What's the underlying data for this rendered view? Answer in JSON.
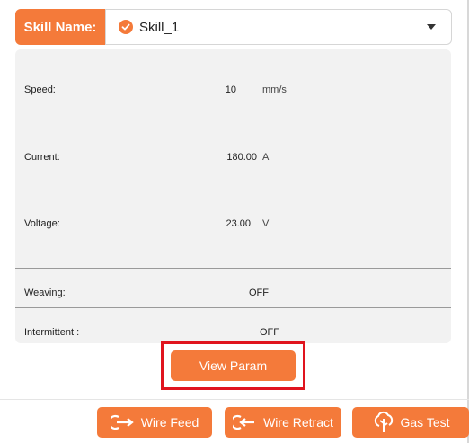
{
  "skill": {
    "label": "Skill Name:",
    "selected": "Skill_1"
  },
  "params": {
    "speed": {
      "label": "Speed:",
      "value": "10",
      "unit": "mm/s"
    },
    "current": {
      "label": "Current:",
      "value": "180.00",
      "unit": "A"
    },
    "voltage": {
      "label": "Voltage:",
      "value": "23.00",
      "unit": "V"
    },
    "weaving": {
      "label": "Weaving:",
      "value": "OFF"
    },
    "intermittent": {
      "label": "Intermittent :",
      "value": "OFF"
    }
  },
  "view_param": {
    "label": "View Param"
  },
  "actions": {
    "wire_feed": {
      "label": "Wire Feed",
      "icon": "wire-feed-icon"
    },
    "wire_retract": {
      "label": "Wire Retract",
      "icon": "wire-retract-icon"
    },
    "gas_test": {
      "label": "Gas Test",
      "icon": "gas-test-icon"
    }
  },
  "colors": {
    "accent": "#f47a3a",
    "highlight": "#e0141e",
    "panel": "#f2f2f2"
  }
}
